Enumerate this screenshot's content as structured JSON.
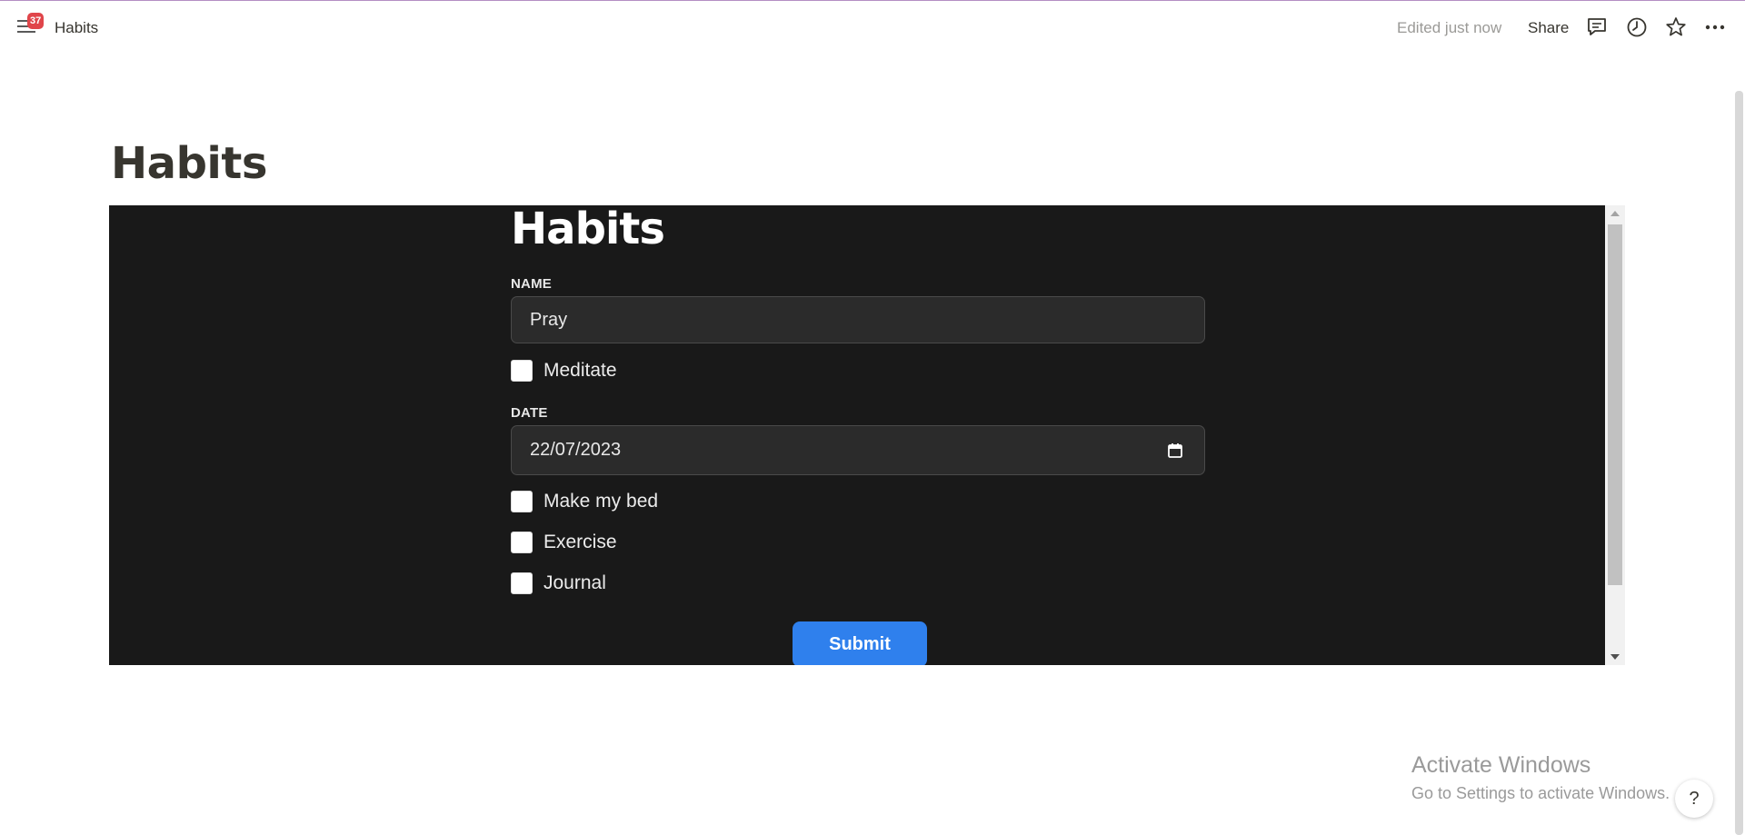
{
  "topbar": {
    "notification_count": "37",
    "breadcrumb": "Habits",
    "edited_status": "Edited just now",
    "share_label": "Share",
    "icons": [
      "menu-icon",
      "comment-icon",
      "clock-icon",
      "star-icon",
      "more-icon"
    ]
  },
  "page": {
    "title": "Habits"
  },
  "embed": {
    "form_title": "Habits",
    "name_label": "NAME",
    "name_value": "Pray",
    "meditate_label": "Meditate",
    "date_label": "DATE",
    "date_value": "22/07/2023",
    "checklist": [
      {
        "label": "Make my bed",
        "checked": false
      },
      {
        "label": "Exercise",
        "checked": false
      },
      {
        "label": "Journal",
        "checked": false
      }
    ],
    "meditate_checked": false,
    "submit_label": "Submit"
  },
  "watermark": {
    "title": "Activate Windows",
    "subtitle": "Go to Settings to activate Windows."
  },
  "help_label": "?",
  "colors": {
    "embed_background": "#191919",
    "submit_button": "#2f80ed",
    "badge": "#e0454a"
  }
}
